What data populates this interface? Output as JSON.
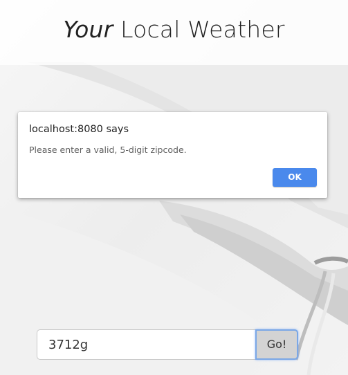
{
  "header": {
    "title_italic": "Your",
    "title_rest": " Local Weather"
  },
  "alert": {
    "origin": "localhost:8080 says",
    "message": "Please enter a valid, 5-digit zipcode.",
    "ok_label": "OK",
    "ok_color": "#4a89ec"
  },
  "search": {
    "zip_value": "3712g",
    "go_label": "Go!"
  }
}
